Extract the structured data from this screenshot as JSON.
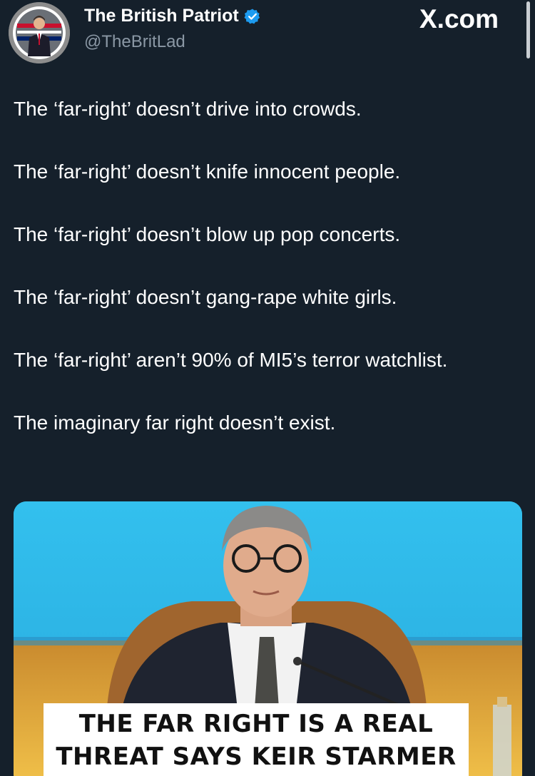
{
  "header": {
    "display_name": "The British Patriot",
    "handle": "@TheBritLad",
    "watermark": "X.com",
    "verified": true,
    "verified_color": "#1d9bf0"
  },
  "tweet": {
    "paragraphs": [
      "The ‘far-right’ doesn’t drive into crowds.",
      "The ‘far-right’ doesn’t knife innocent people.",
      "The ‘far-right’ doesn’t blow up pop concerts.",
      "The ‘far-right’ doesn’t gang-rape white girls.",
      "The ‘far-right’ aren’t 90% of MI5’s terror watchlist.",
      "The imaginary far right doesn’t exist."
    ]
  },
  "media": {
    "caption_line1": "THE FAR RIGHT IS A REAL",
    "caption_line2": "THREAT SAYS KEIR STARMER",
    "background_color": "#2fb6e3"
  },
  "colors": {
    "background": "#15202b",
    "text": "#ffffff",
    "secondary_text": "#8b98a5"
  },
  "icons": {
    "verified": "verified-badge-icon",
    "avatar": "avatar-image"
  }
}
